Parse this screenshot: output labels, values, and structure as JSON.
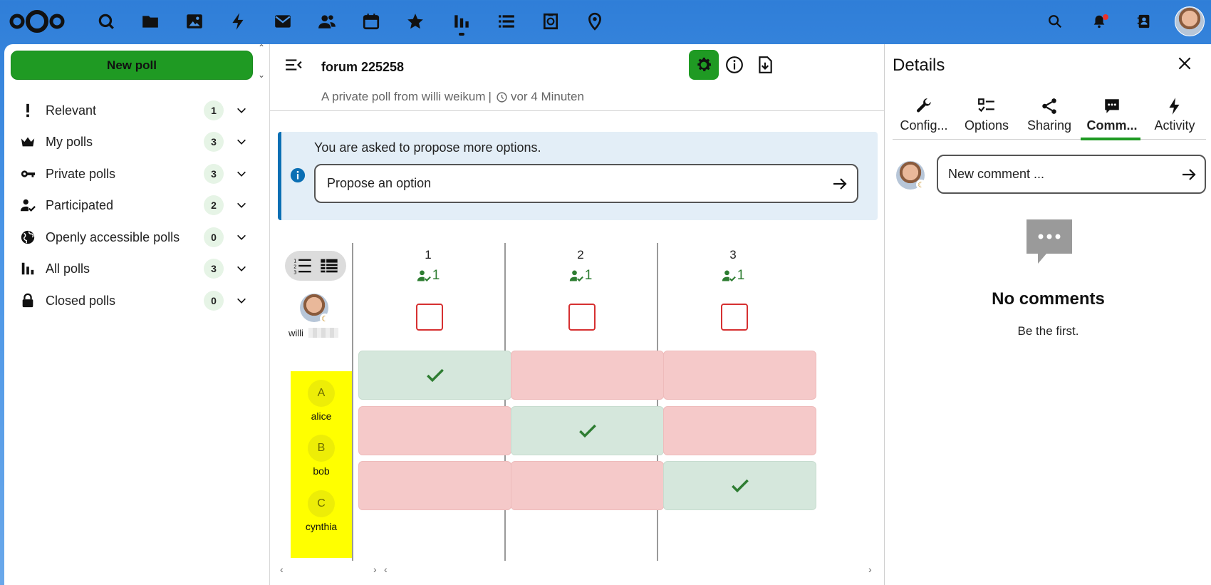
{
  "colors": {
    "accent": "#1f9a23",
    "topbar": "#2f7ed8",
    "yes_cell": "#d5e7dc",
    "no_cell": "#f5c9c9",
    "info_border": "#0b6fb4",
    "highlight": "#ffff00"
  },
  "topbar": {
    "apps": [
      "search-icon",
      "files-icon",
      "photos-icon",
      "activity-icon",
      "mail-icon",
      "contacts-icon",
      "calendar-icon",
      "star-icon",
      "polls-icon",
      "tasks-icon",
      "forms-icon",
      "maps-icon"
    ],
    "right_icons": [
      "search-icon",
      "notifications-icon",
      "contacts-menu-icon",
      "avatar"
    ]
  },
  "leftnav": {
    "new_poll_label": "New poll",
    "items": [
      {
        "label": "Relevant",
        "count": "1",
        "icon": "exclamation-icon"
      },
      {
        "label": "My polls",
        "count": "3",
        "icon": "crown-icon"
      },
      {
        "label": "Private polls",
        "count": "3",
        "icon": "key-icon"
      },
      {
        "label": "Participated",
        "count": "2",
        "icon": "account-check-icon"
      },
      {
        "label": "Openly accessible polls",
        "count": "0",
        "icon": "globe-icon"
      },
      {
        "label": "All polls",
        "count": "3",
        "icon": "chart-bar-icon"
      },
      {
        "label": "Closed polls",
        "count": "0",
        "icon": "lock-icon"
      }
    ]
  },
  "main": {
    "title": "forum 225258",
    "subtitle": "A private poll from willi weikum",
    "separator": "|",
    "time": "vor 4 Minuten",
    "info_text": "You are asked to propose more options.",
    "propose_placeholder": "Propose an option",
    "owner_name": "willi",
    "options": [
      {
        "label": "1",
        "votes": "1"
      },
      {
        "label": "2",
        "votes": "1"
      },
      {
        "label": "3",
        "votes": "1"
      }
    ],
    "participants": [
      {
        "initial": "A",
        "name": "alice",
        "votes": [
          "yes",
          "no",
          "no"
        ]
      },
      {
        "initial": "B",
        "name": "bob",
        "votes": [
          "no",
          "yes",
          "no"
        ]
      },
      {
        "initial": "C",
        "name": "cynthia",
        "votes": [
          "no",
          "no",
          "yes"
        ]
      }
    ]
  },
  "sidebar": {
    "title": "Details",
    "tabs": [
      {
        "label": "Config...",
        "icon": "wrench-icon"
      },
      {
        "label": "Options",
        "icon": "checklist-icon"
      },
      {
        "label": "Sharing",
        "icon": "share-icon"
      },
      {
        "label": "Comm...",
        "icon": "comment-icon",
        "active": true
      },
      {
        "label": "Activity",
        "icon": "lightning-icon"
      }
    ],
    "comment_placeholder": "New comment ...",
    "empty_title": "No comments",
    "empty_subtitle": "Be the first."
  }
}
